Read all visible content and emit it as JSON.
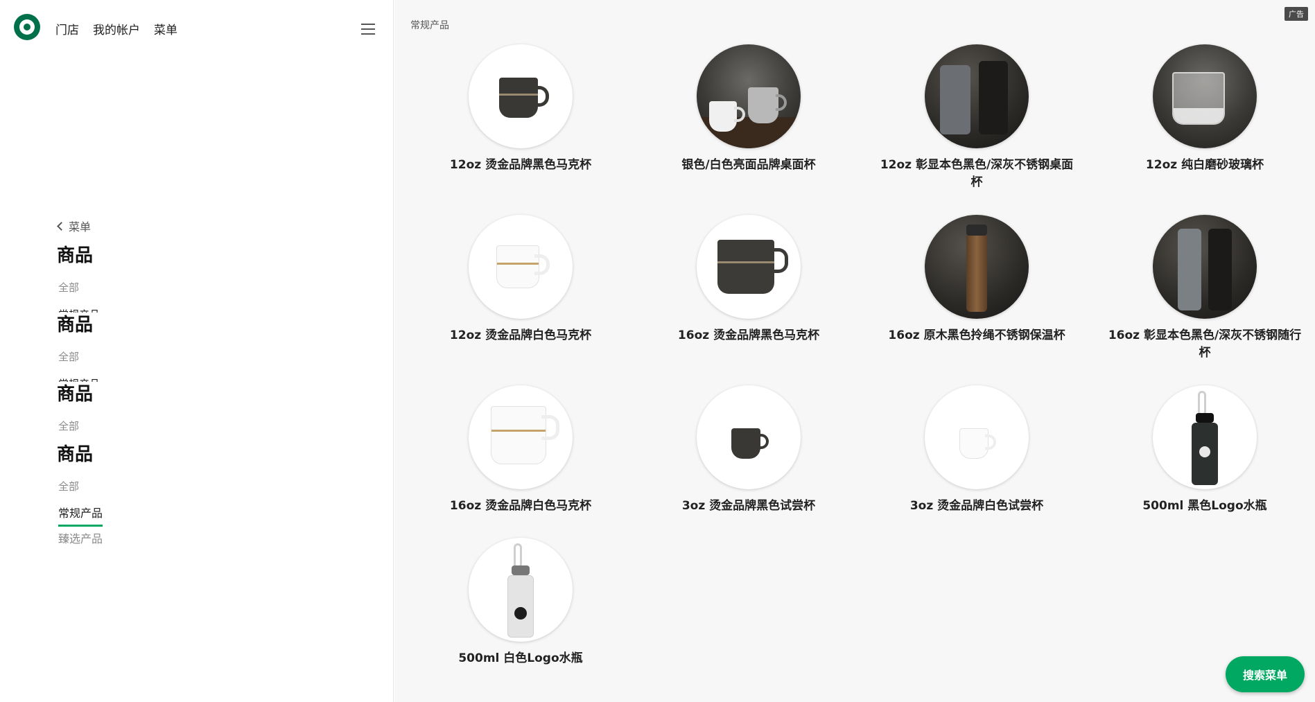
{
  "nav": {
    "links": [
      "门店",
      "我的帐户",
      "菜单"
    ]
  },
  "sidebar": {
    "back_label": "菜单",
    "section_title": "商品",
    "all_label": "全部",
    "clipped_label": "常规产品",
    "active_label": "常规产品",
    "other_label": "臻选产品"
  },
  "main": {
    "breadcrumb": "常规产品",
    "ad_label": "广告",
    "products": [
      "12oz 烫金品牌黑色马克杯",
      "银色/白色亮面品牌桌面杯",
      "12oz 彰显本色黑色/深灰不锈钢桌面杯",
      "12oz 纯白磨砂玻璃杯",
      "12oz 烫金品牌白色马克杯",
      "16oz 烫金品牌黑色马克杯",
      "16oz 原木黑色拎绳不锈钢保温杯",
      "16oz 彰显本色黑色/深灰不锈钢随行杯",
      "16oz 烫金品牌白色马克杯",
      "3oz 烫金品牌黑色试尝杯",
      "3oz 烫金品牌白色试尝杯",
      "500ml 黑色Logo水瓶",
      "500ml 白色Logo水瓶"
    ]
  },
  "search_button": "搜索菜单",
  "colors": {
    "brand_green": "#00704a",
    "accent_green": "#00a862"
  }
}
